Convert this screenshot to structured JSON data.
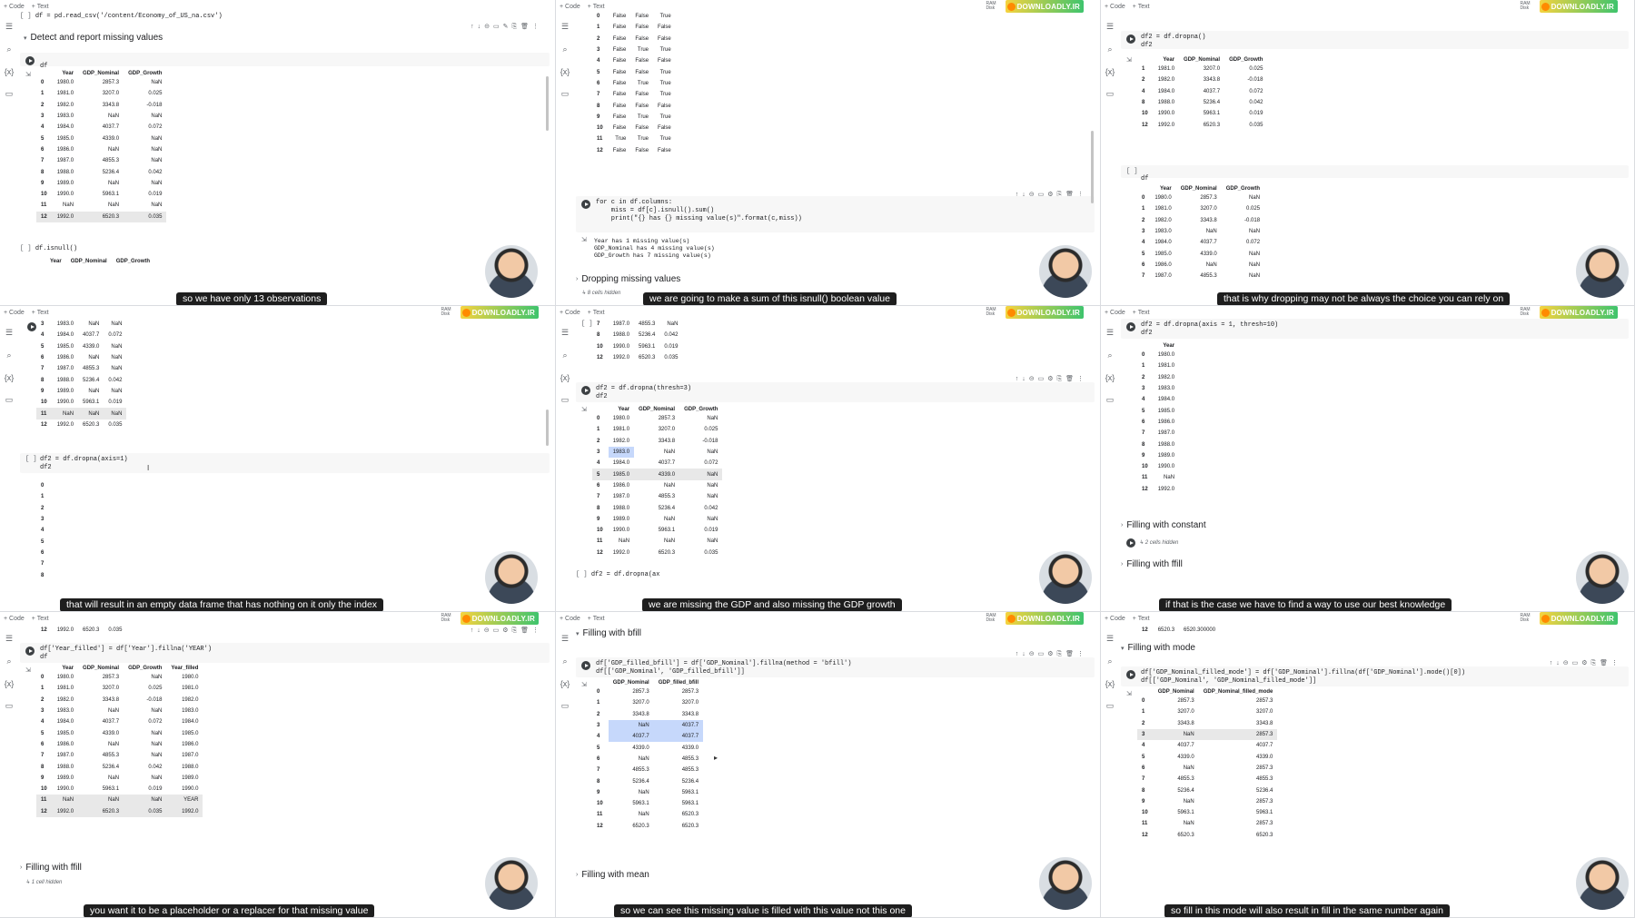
{
  "toolbar": {
    "code": "+ Code",
    "text": "+ Text",
    "ram": "RAM",
    "disk": "Disk",
    "logo": "DOWNLOADLY.IR"
  },
  "p1": {
    "code_line": "df = pd.read_csv('/content/Economy_of_US_na.csv')",
    "section": "Detect and report missing values",
    "cell_df": "df",
    "cols": [
      "Year",
      "GDP_Nominal",
      "GDP_Growth"
    ],
    "rows": [
      [
        "0",
        "1980.0",
        "2857.3",
        "NaN"
      ],
      [
        "1",
        "1981.0",
        "3207.0",
        "0.025"
      ],
      [
        "2",
        "1982.0",
        "3343.8",
        "-0.018"
      ],
      [
        "3",
        "1983.0",
        "NaN",
        "NaN"
      ],
      [
        "4",
        "1984.0",
        "4037.7",
        "0.072"
      ],
      [
        "5",
        "1985.0",
        "4339.0",
        "NaN"
      ],
      [
        "6",
        "1986.0",
        "NaN",
        "NaN"
      ],
      [
        "7",
        "1987.0",
        "4855.3",
        "NaN"
      ],
      [
        "8",
        "1988.0",
        "5236.4",
        "0.042"
      ],
      [
        "9",
        "1989.0",
        "NaN",
        "NaN"
      ],
      [
        "10",
        "1990.0",
        "5963.1",
        "0.019"
      ],
      [
        "11",
        "NaN",
        "NaN",
        "NaN"
      ],
      [
        "12",
        "1992.0",
        "6520.3",
        "0.035"
      ]
    ],
    "isnull_cell": "df.isnull()",
    "caption": "so we have only 13 observations"
  },
  "p2": {
    "rows": [
      [
        "0",
        "False",
        "False",
        "True"
      ],
      [
        "1",
        "False",
        "False",
        "False"
      ],
      [
        "2",
        "False",
        "False",
        "False"
      ],
      [
        "3",
        "False",
        "True",
        "True"
      ],
      [
        "4",
        "False",
        "False",
        "False"
      ],
      [
        "5",
        "False",
        "False",
        "True"
      ],
      [
        "6",
        "False",
        "True",
        "True"
      ],
      [
        "7",
        "False",
        "False",
        "True"
      ],
      [
        "8",
        "False",
        "False",
        "False"
      ],
      [
        "9",
        "False",
        "True",
        "True"
      ],
      [
        "10",
        "False",
        "False",
        "False"
      ],
      [
        "11",
        "True",
        "True",
        "True"
      ],
      [
        "12",
        "False",
        "False",
        "False"
      ]
    ],
    "code": [
      "for c in df.columns:",
      "    miss = df[c].isnull().sum()",
      "    print(\"{} has {} missing value(s)\".format(c,miss))"
    ],
    "output": [
      "Year has 1 missing value(s)",
      "GDP_Nominal has 4 missing value(s)",
      "GDP_Growth has 7 missing value(s)"
    ],
    "section": "Dropping missing values",
    "hidden": "↳ 8 cells hidden",
    "caption": "we are going to make a sum of this isnull() boolean value"
  },
  "p3": {
    "code": [
      "df2 = df.dropna()",
      "df2"
    ],
    "cols": [
      "Year",
      "GDP_Nominal",
      "GDP_Growth"
    ],
    "rows": [
      [
        "1",
        "1981.0",
        "3207.0",
        "0.025"
      ],
      [
        "2",
        "1982.0",
        "3343.8",
        "-0.018"
      ],
      [
        "4",
        "1984.0",
        "4037.7",
        "0.072"
      ],
      [
        "8",
        "1988.0",
        "5236.4",
        "0.042"
      ],
      [
        "10",
        "1990.0",
        "5963.1",
        "0.019"
      ],
      [
        "12",
        "1992.0",
        "6520.3",
        "0.035"
      ]
    ],
    "cell_df": "df",
    "rows2": [
      [
        "0",
        "1980.0",
        "2857.3",
        "NaN"
      ],
      [
        "1",
        "1981.0",
        "3207.0",
        "0.025"
      ],
      [
        "2",
        "1982.0",
        "3343.8",
        "-0.018"
      ],
      [
        "3",
        "1983.0",
        "NaN",
        "NaN"
      ],
      [
        "4",
        "1984.0",
        "4037.7",
        "0.072"
      ],
      [
        "5",
        "1985.0",
        "4339.0",
        "NaN"
      ],
      [
        "6",
        "1986.0",
        "NaN",
        "NaN"
      ],
      [
        "7",
        "1987.0",
        "4855.3",
        "NaN"
      ]
    ],
    "caption": "that is why dropping may not be always the choice you can rely on"
  },
  "p4": {
    "rows": [
      [
        "3",
        "1983.0",
        "NaN",
        "NaN"
      ],
      [
        "4",
        "1984.0",
        "4037.7",
        "0.072"
      ],
      [
        "5",
        "1985.0",
        "4339.0",
        "NaN"
      ],
      [
        "6",
        "1986.0",
        "NaN",
        "NaN"
      ],
      [
        "7",
        "1987.0",
        "4855.3",
        "NaN"
      ],
      [
        "8",
        "1988.0",
        "5236.4",
        "0.042"
      ],
      [
        "9",
        "1989.0",
        "NaN",
        "NaN"
      ],
      [
        "10",
        "1990.0",
        "5963.1",
        "0.019"
      ],
      [
        "11",
        "NaN",
        "NaN",
        "NaN"
      ],
      [
        "12",
        "1992.0",
        "6520.3",
        "0.035"
      ]
    ],
    "code": [
      "df2 = df.dropna(axis=1)",
      "df2"
    ],
    "index": [
      "0",
      "1",
      "2",
      "3",
      "4",
      "5",
      "6",
      "7",
      "8"
    ],
    "caption": "that will result in an empty data frame that has nothing on it only the index"
  },
  "p5": {
    "rows_top": [
      [
        "7",
        "1987.0",
        "4855.3",
        "NaN"
      ],
      [
        "8",
        "1988.0",
        "5236.4",
        "0.042"
      ],
      [
        "10",
        "1990.0",
        "5963.1",
        "0.019"
      ],
      [
        "12",
        "1992.0",
        "6520.3",
        "0.035"
      ]
    ],
    "code": [
      "df2 = df.dropna(thresh=3)",
      "df2"
    ],
    "cols": [
      "Year",
      "GDP_Nominal",
      "GDP_Growth"
    ],
    "rows": [
      [
        "0",
        "1980.0",
        "2857.3",
        "NaN"
      ],
      [
        "1",
        "1981.0",
        "3207.0",
        "0.025"
      ],
      [
        "2",
        "1982.0",
        "3343.8",
        "-0.018"
      ],
      [
        "3",
        "1983.0",
        "NaN",
        "NaN"
      ],
      [
        "4",
        "1984.0",
        "4037.7",
        "0.072"
      ],
      [
        "5",
        "1985.0",
        "4339.0",
        "NaN"
      ],
      [
        "6",
        "1986.0",
        "NaN",
        "NaN"
      ],
      [
        "7",
        "1987.0",
        "4855.3",
        "NaN"
      ],
      [
        "8",
        "1988.0",
        "5236.4",
        "0.042"
      ],
      [
        "9",
        "1989.0",
        "NaN",
        "NaN"
      ],
      [
        "10",
        "1990.0",
        "5963.1",
        "0.019"
      ],
      [
        "11",
        "NaN",
        "NaN",
        "NaN"
      ],
      [
        "12",
        "1992.0",
        "6520.3",
        "0.035"
      ]
    ],
    "next_code": "df2 = df.dropna(ax",
    "caption": "we are missing the GDP and also missing the GDP growth"
  },
  "p6": {
    "code": [
      "df2 = df.dropna(axis = 1, thresh=10)",
      "df2"
    ],
    "col": "Year",
    "rows": [
      [
        "0",
        "1980.0"
      ],
      [
        "1",
        "1981.0"
      ],
      [
        "2",
        "1982.0"
      ],
      [
        "3",
        "1983.0"
      ],
      [
        "4",
        "1984.0"
      ],
      [
        "5",
        "1985.0"
      ],
      [
        "6",
        "1986.0"
      ],
      [
        "7",
        "1987.0"
      ],
      [
        "8",
        "1988.0"
      ],
      [
        "9",
        "1989.0"
      ],
      [
        "10",
        "1990.0"
      ],
      [
        "11",
        "NaN"
      ],
      [
        "12",
        "1992.0"
      ]
    ],
    "section1": "Filling with constant",
    "hidden": "↳ 2 cells hidden",
    "section2": "Filling with ffill",
    "caption": "if that is the case we have to find a way to use our best knowledge"
  },
  "p7": {
    "top_row": [
      "12",
      "1992.0",
      "6520.3",
      "0.035"
    ],
    "code": [
      "df['Year_filled'] = df['Year'].fillna('YEAR')",
      "df"
    ],
    "cols": [
      "Year",
      "GDP_Nominal",
      "GDP_Growth",
      "Year_filled"
    ],
    "rows": [
      [
        "0",
        "1980.0",
        "2857.3",
        "NaN",
        "1980.0"
      ],
      [
        "1",
        "1981.0",
        "3207.0",
        "0.025",
        "1981.0"
      ],
      [
        "2",
        "1982.0",
        "3343.8",
        "-0.018",
        "1982.0"
      ],
      [
        "3",
        "1983.0",
        "NaN",
        "NaN",
        "1983.0"
      ],
      [
        "4",
        "1984.0",
        "4037.7",
        "0.072",
        "1984.0"
      ],
      [
        "5",
        "1985.0",
        "4339.0",
        "NaN",
        "1985.0"
      ],
      [
        "6",
        "1986.0",
        "NaN",
        "NaN",
        "1986.0"
      ],
      [
        "7",
        "1987.0",
        "4855.3",
        "NaN",
        "1987.0"
      ],
      [
        "8",
        "1988.0",
        "5236.4",
        "0.042",
        "1988.0"
      ],
      [
        "9",
        "1989.0",
        "NaN",
        "NaN",
        "1989.0"
      ],
      [
        "10",
        "1990.0",
        "5963.1",
        "0.019",
        "1990.0"
      ],
      [
        "11",
        "NaN",
        "NaN",
        "NaN",
        "YEAR"
      ],
      [
        "12",
        "1992.0",
        "6520.3",
        "0.035",
        "1992.0"
      ]
    ],
    "section": "Filling with ffill",
    "hidden": "↳ 1 cell hidden",
    "caption": "you want it to be a placeholder or a replacer for that missing value"
  },
  "p8": {
    "section": "Filling with bfill",
    "code": [
      "df['GDP_filled_bfill'] = df['GDP_Nominal'].fillna(method = 'bfill')",
      "df[['GDP_Nominal', 'GDP_filled_bfill']]"
    ],
    "cols": [
      "GDP_Nominal",
      "GDP_filled_bfill"
    ],
    "rows": [
      [
        "0",
        "2857.3",
        "2857.3"
      ],
      [
        "1",
        "3207.0",
        "3207.0"
      ],
      [
        "2",
        "3343.8",
        "3343.8"
      ],
      [
        "3",
        "NaN",
        "4037.7"
      ],
      [
        "4",
        "4037.7",
        "4037.7"
      ],
      [
        "5",
        "4339.0",
        "4339.0"
      ],
      [
        "6",
        "NaN",
        "4855.3"
      ],
      [
        "7",
        "4855.3",
        "4855.3"
      ],
      [
        "8",
        "5236.4",
        "5236.4"
      ],
      [
        "9",
        "NaN",
        "5963.1"
      ],
      [
        "10",
        "5963.1",
        "5963.1"
      ],
      [
        "11",
        "NaN",
        "6520.3"
      ],
      [
        "12",
        "6520.3",
        "6520.3"
      ]
    ],
    "section2": "Filling with mean",
    "caption": "so we can see this missing value is filled with this value not this one"
  },
  "p9": {
    "top_row": [
      "12",
      "6520.3",
      "6520.300000"
    ],
    "section": "Filling with mode",
    "code": [
      "df['GDP_Nominal_filled_mode'] = df['GDP_Nominal'].fillna(df['GDP_Nominal'].mode()[0])",
      "df[['GDP_Nominal', 'GDP_Nominal_filled_mode']]"
    ],
    "cols": [
      "GDP_Nominal",
      "GDP_Nominal_filled_mode"
    ],
    "rows": [
      [
        "0",
        "2857.3",
        "2857.3"
      ],
      [
        "1",
        "3207.0",
        "3207.0"
      ],
      [
        "2",
        "3343.8",
        "3343.8"
      ],
      [
        "3",
        "NaN",
        "2857.3"
      ],
      [
        "4",
        "4037.7",
        "4037.7"
      ],
      [
        "5",
        "4339.0",
        "4339.0"
      ],
      [
        "6",
        "NaN",
        "2857.3"
      ],
      [
        "7",
        "4855.3",
        "4855.3"
      ],
      [
        "8",
        "5236.4",
        "5236.4"
      ],
      [
        "9",
        "NaN",
        "2857.3"
      ],
      [
        "10",
        "5963.1",
        "5963.1"
      ],
      [
        "11",
        "NaN",
        "2857.3"
      ],
      [
        "12",
        "6520.3",
        "6520.3"
      ]
    ],
    "caption": "so fill in this mode will also result in fill in the same number again"
  }
}
